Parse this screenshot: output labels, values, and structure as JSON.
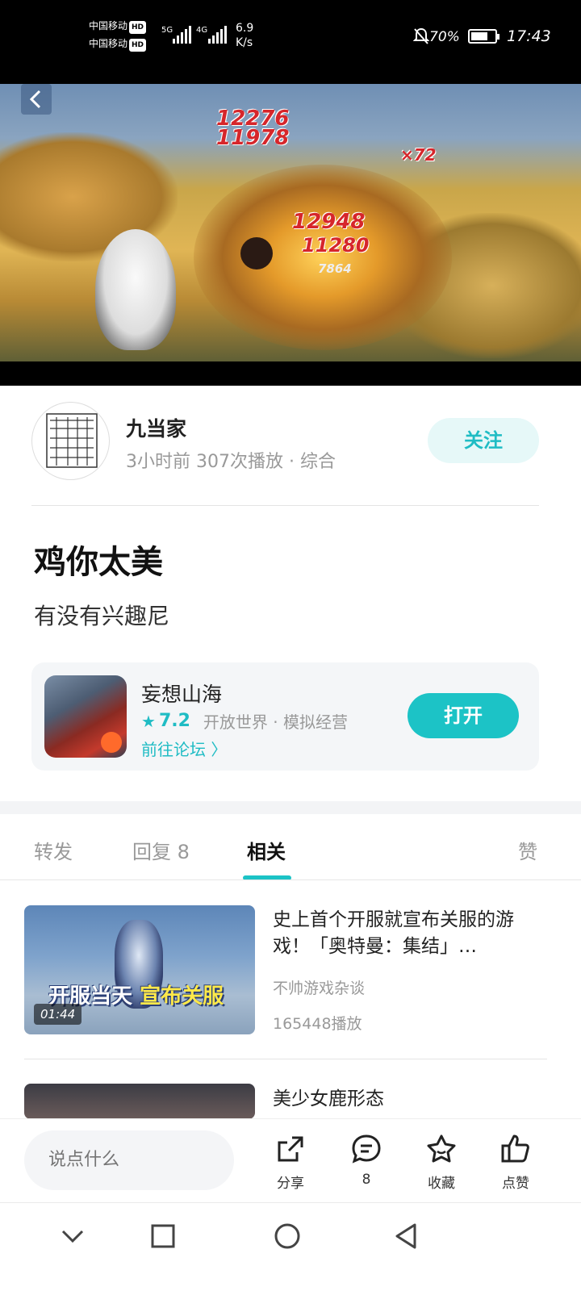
{
  "status_bar": {
    "carrier1": "中国移动",
    "carrier2": "中国移动",
    "hd": "HD",
    "net1": "5G",
    "net2": "4G",
    "speed_value": "6.9",
    "speed_unit": "K/s",
    "battery_pct": "70%",
    "battery_level": 0.7,
    "time": "17:43"
  },
  "video": {
    "damage_numbers": [
      "12276",
      "11978",
      "12948",
      "11280",
      "7864",
      "×72"
    ]
  },
  "author": {
    "name": "九当家",
    "meta": "3小时前   307次播放 · 综合",
    "follow_label": "关注"
  },
  "post": {
    "title": "鸡你太美",
    "body": "有没有兴趣尼"
  },
  "game_card": {
    "name": "妄想山海",
    "rating": "7.2",
    "tags": "开放世界 · 模拟经营",
    "forum_link": "前往论坛 〉",
    "open_label": "打开"
  },
  "tabs": {
    "forward": "转发",
    "reply": "回复 8",
    "related": "相关",
    "like": "赞"
  },
  "related": [
    {
      "title": "史上首个开服就宣布关服的游戏！「奥特曼：集结」…",
      "author": "不帅游戏杂谈",
      "plays": "165448播放",
      "duration": "01:44",
      "banner_text": "开服当天",
      "banner_highlight": "宣布关服"
    },
    {
      "title": "美少女鹿形态"
    }
  ],
  "action_bar": {
    "comment_placeholder": "说点什么",
    "share_label": "分享",
    "comment_count": "8",
    "favorite_label": "收藏",
    "like_label": "点赞"
  },
  "colors": {
    "accent": "#1cc3c6",
    "follow_bg": "#e6f8f8"
  }
}
